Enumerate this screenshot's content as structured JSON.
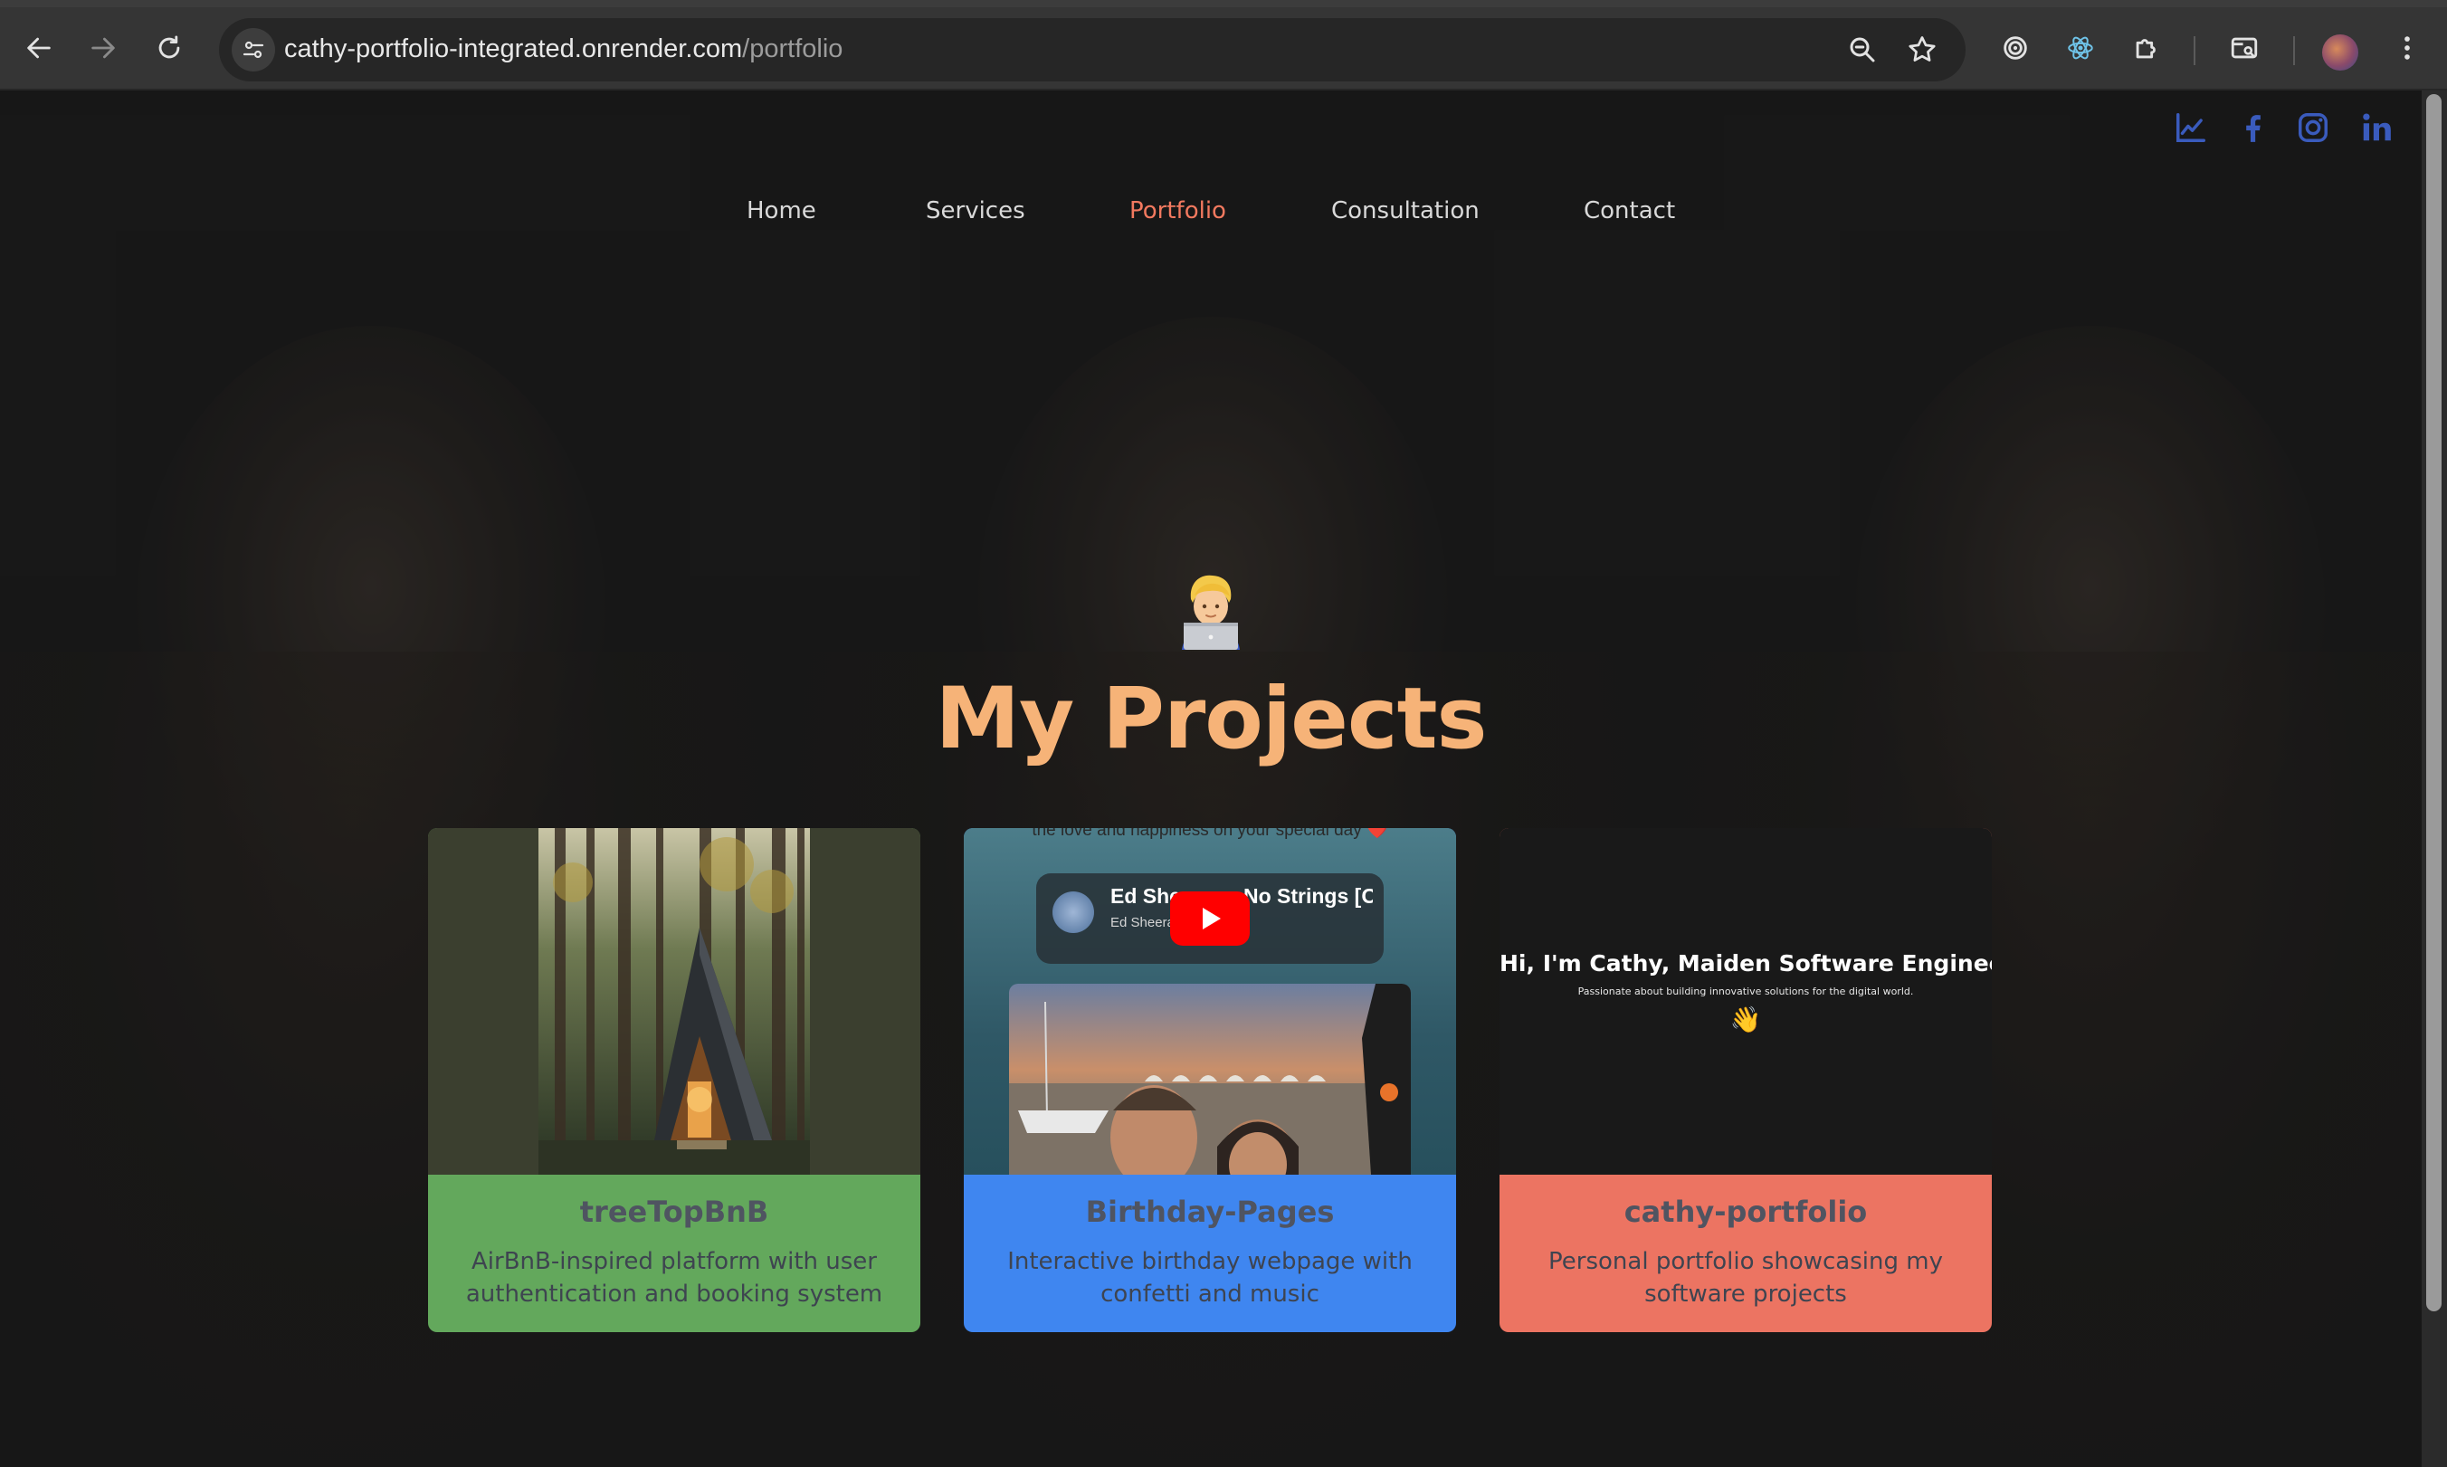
{
  "browser": {
    "url_host": "cathy-portfolio-integrated.onrender.com",
    "url_path": "/portfolio",
    "icons": [
      "back-icon",
      "forward-icon",
      "reload-icon",
      "site-info-icon",
      "zoom-icon",
      "bookmark-star-icon",
      "extension-target-icon",
      "react-devtools-icon",
      "extensions-puzzle-icon",
      "tab-search-icon",
      "profile-avatar",
      "menu-icon"
    ]
  },
  "social": [
    "chart-icon",
    "facebook-icon",
    "instagram-icon",
    "linkedin-icon"
  ],
  "nav": {
    "items": [
      {
        "label": "Home"
      },
      {
        "label": "Services"
      },
      {
        "label": "Portfolio",
        "active": true
      },
      {
        "label": "Consultation"
      },
      {
        "label": "Contact"
      }
    ]
  },
  "hero": {
    "emoji": "man-technologist-emoji",
    "title": "My Projects"
  },
  "projects": [
    {
      "title": "treeTopBnB",
      "description": "AirBnB-inspired platform with user authentication and booking system",
      "color": "#63a85c",
      "thumb": "a-frame-cabin-forest-image"
    },
    {
      "title": "Birthday-Pages",
      "description": "Interactive birthday webpage with confetti and music",
      "color": "#3f86f0",
      "thumb": "birthday-page-screenshot",
      "embed": {
        "caption_top": "the love and happiness on your special day ❤️",
        "video_title": "Ed Sheeran - No Strings [O",
        "channel": "Ed Sheeran"
      }
    },
    {
      "title": "cathy-portfolio",
      "description": "Personal portfolio showcasing my software projects",
      "color": "#ec7462",
      "thumb": "portfolio-screenshot",
      "preview": {
        "heading": "Hi, I'm Cathy, Maiden Software Engineer",
        "tagline": "Passionate about building innovative solutions for the digital world.",
        "emoji": "👋"
      }
    }
  ],
  "colors": {
    "accent": "#f2795f",
    "title": "#f6b378",
    "social": "#3a5bbd"
  }
}
